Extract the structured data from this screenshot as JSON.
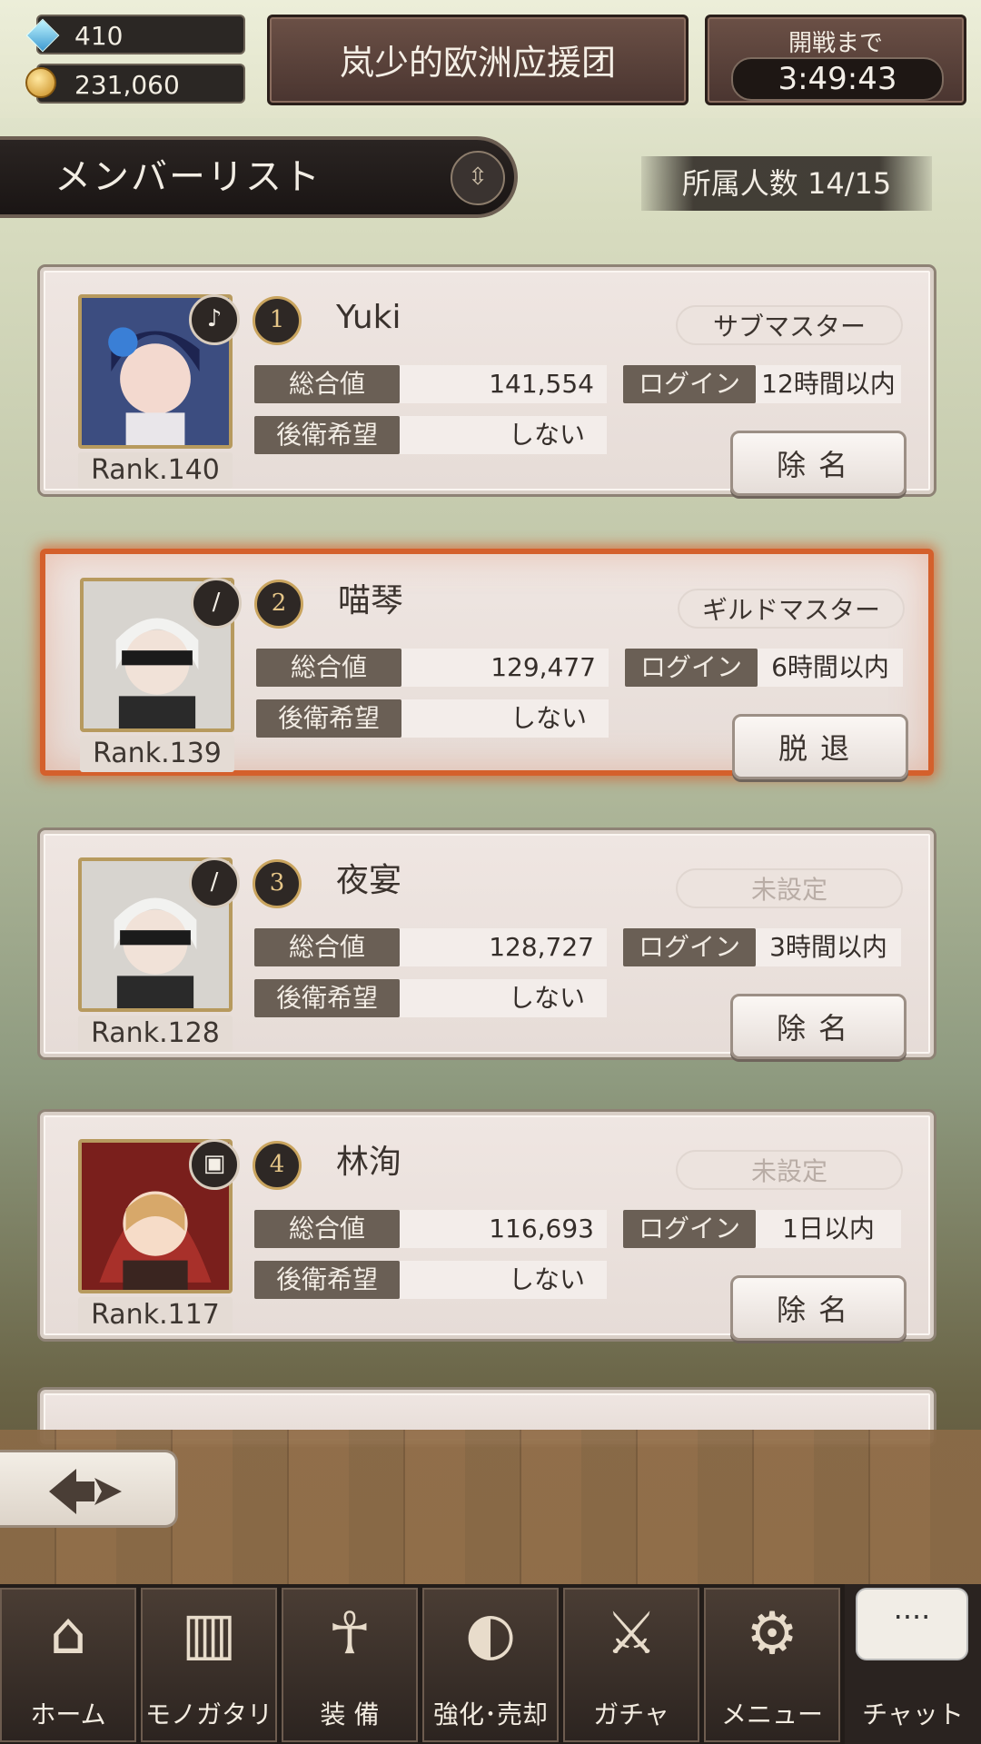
{
  "resources": {
    "gems": "410",
    "gold": "231,060"
  },
  "header": {
    "guild_name": "岚少的欧洲应援团",
    "battle_label": "開戦まで",
    "battle_timer": "3:49:43"
  },
  "list": {
    "title": "メンバーリスト",
    "member_count": "所属人数 14/15"
  },
  "labels": {
    "total": "総合値",
    "login": "ログイン",
    "rear": "後衛希望"
  },
  "members": [
    {
      "rank_no": "1",
      "name": "Yuki",
      "role": "サブマスター",
      "total": "141,554",
      "login": "12時間以内",
      "rear": "しない",
      "action": "除名",
      "rank": "Rank.140",
      "job_icon": "harp-icon"
    },
    {
      "rank_no": "2",
      "name": "喵琴",
      "role": "ギルドマスター",
      "total": "129,477",
      "login": "6時間以内",
      "rear": "しない",
      "action": "脱退",
      "rank": "Rank.139",
      "job_icon": "spear-icon"
    },
    {
      "rank_no": "3",
      "name": "夜宴",
      "role": "未設定",
      "total": "128,727",
      "login": "3時間以内",
      "rear": "しない",
      "action": "除名",
      "rank": "Rank.128",
      "job_icon": "spear-icon"
    },
    {
      "rank_no": "4",
      "name": "林洵",
      "role": "未設定",
      "total": "116,693",
      "login": "1日以内",
      "rear": "しない",
      "action": "除名",
      "rank": "Rank.117",
      "job_icon": "book-icon"
    }
  ],
  "nav": [
    {
      "label": "ホーム",
      "icon": "castle-icon"
    },
    {
      "label": "モノガタリ",
      "icon": "open-book-icon"
    },
    {
      "label": "装 備",
      "icon": "puppet-icon"
    },
    {
      "label": "強化･売却",
      "icon": "mask-icon"
    },
    {
      "label": "ガチャ",
      "icon": "crossed-swords-icon"
    },
    {
      "label": "メニュー",
      "icon": "gears-icon"
    }
  ],
  "chat": {
    "label": "チャット",
    "bubble": "····"
  }
}
